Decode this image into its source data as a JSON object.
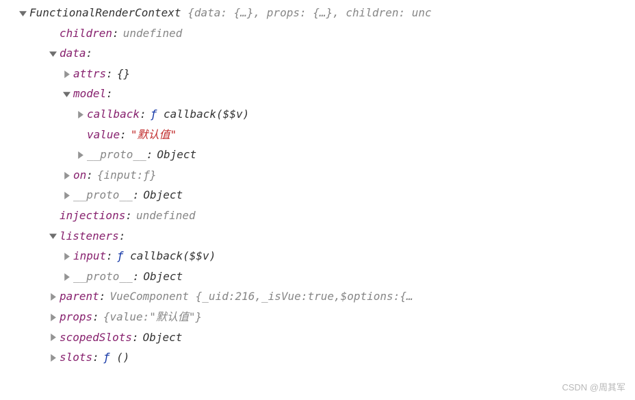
{
  "root": {
    "name": "FunctionalRenderContext",
    "preview": "{data: {…}, props: {…}, children: unc"
  },
  "children": {
    "key": "children",
    "val": "undefined"
  },
  "data": {
    "key": "data",
    "attrs": {
      "key": "attrs",
      "val": "{}"
    },
    "model": {
      "key": "model",
      "callback": {
        "key": "callback",
        "sig": "callback($$v)"
      },
      "value": {
        "key": "value",
        "val": "\"默认值\""
      },
      "proto": {
        "key": "__proto__",
        "val": "Object"
      }
    },
    "on": {
      "key": "on",
      "val": "{input: ",
      "f": "ƒ",
      "close": "}"
    },
    "proto": {
      "key": "__proto__",
      "val": "Object"
    }
  },
  "injections": {
    "key": "injections",
    "val": "undefined"
  },
  "listeners": {
    "key": "listeners",
    "input": {
      "key": "input",
      "sig": "callback($$v)"
    },
    "proto": {
      "key": "__proto__",
      "val": "Object"
    }
  },
  "parent": {
    "key": "parent",
    "type": "VueComponent",
    "uidkey": "_uid",
    "uid": "216",
    "isvuekey": "_isVue",
    "isvue": "true",
    "optkey": "$options",
    "tail": "{…"
  },
  "props": {
    "key": "props",
    "prev1": "{value: ",
    "val": "\"默认值\"",
    "close": "}"
  },
  "scopedSlots": {
    "key": "scopedSlots",
    "val": "Object"
  },
  "slots": {
    "key": "slots",
    "sig": "()"
  },
  "glyph": {
    "f": "ƒ"
  },
  "watermark": "CSDN @周其军"
}
